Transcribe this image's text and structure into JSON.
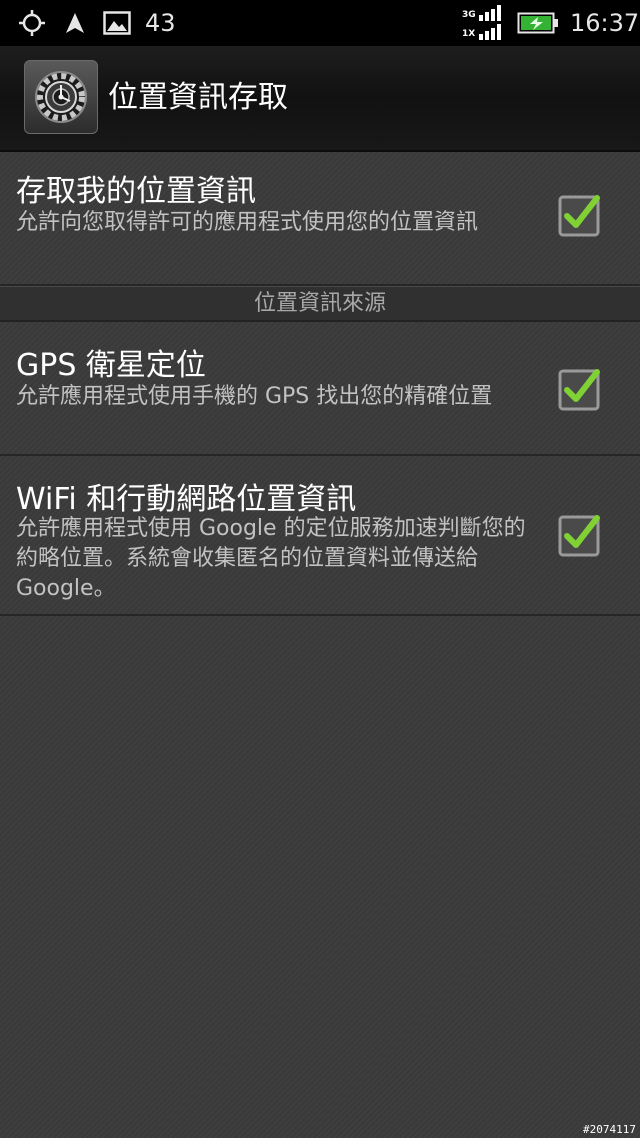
{
  "status_bar": {
    "icons": [
      "gps-target-icon",
      "navigation-arrow-icon",
      "image-icon",
      "signal-3g-icon",
      "signal-1x-icon",
      "battery-charging-icon"
    ],
    "notification_count": "43",
    "net_3g": "3G",
    "net_1x": "1X",
    "time": "16:37"
  },
  "action_bar": {
    "app_icon": "settings-gear-icon",
    "title": "位置資訊存取"
  },
  "prefs": {
    "access_location": {
      "title": "存取我的位置資訊",
      "summary": "允許向您取得許可的應用程式使用您的位置資訊",
      "checked": true
    },
    "section_header": "位置資訊來源",
    "gps": {
      "title": "GPS 衛星定位",
      "summary": "允許應用程式使用手機的 GPS 找出您的精確位置",
      "checked": true
    },
    "wifi": {
      "title": "WiFi 和行動網路位置資訊",
      "summary": "允許應用程式使用 Google 的定位服務加速判斷您的約略位置。系統會收集匿名的位置資料並傳送給 Google。",
      "checked": true
    }
  },
  "watermark": "#2074117",
  "colors": {
    "background": "#3a3a3a",
    "checkmark": "#7fd134",
    "status_bar": "#000000"
  }
}
